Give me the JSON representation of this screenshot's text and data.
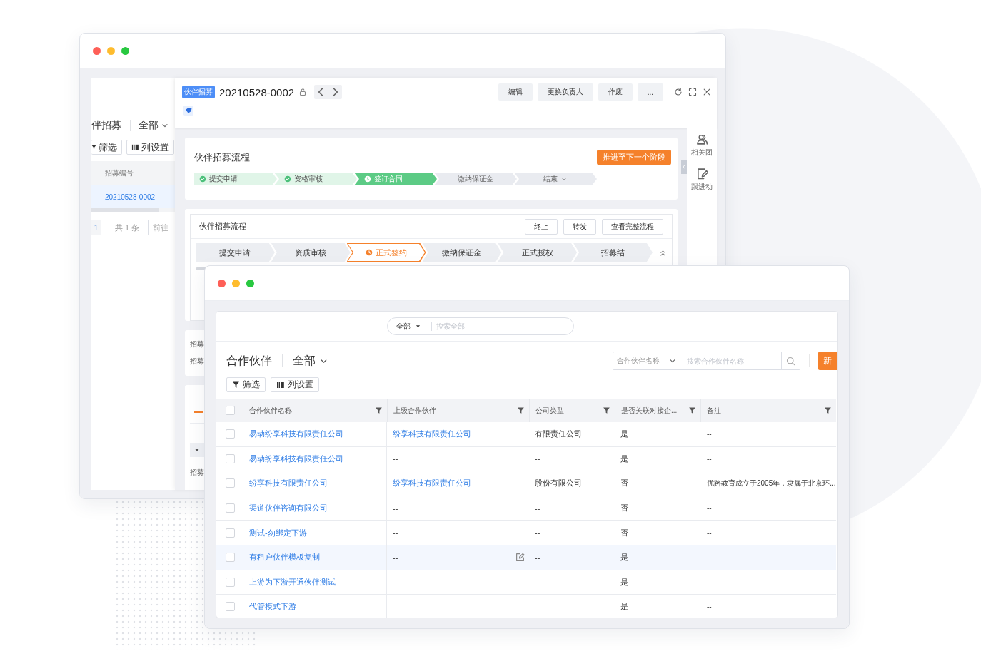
{
  "back_window": {
    "list_panel": {
      "title": "伴招募",
      "view": "全部",
      "filter_button": "筛选",
      "columns_button": "列设置",
      "columns": [
        "招募编号"
      ],
      "rows": [
        {
          "number": "20210528-0002",
          "selected": true
        }
      ],
      "pager": {
        "page": "1",
        "total": "共 1 条",
        "goto": "前往"
      }
    },
    "detail": {
      "type_tag": "伙伴招募",
      "record_number": "20210528-0002",
      "actions": [
        "编辑",
        "更换负责人",
        "作废",
        "..."
      ],
      "stage_card": {
        "title": "伙伴招募流程",
        "advance_button": "推进至下一个阶段",
        "stages": [
          {
            "label": "提交申请",
            "completed": true,
            "current": false,
            "dropdown": false
          },
          {
            "label": "资格审核",
            "completed": true,
            "current": false,
            "dropdown": false
          },
          {
            "label": "签订合同",
            "completed": false,
            "current": true,
            "dropdown": false
          },
          {
            "label": "缴纳保证金",
            "completed": false,
            "current": false,
            "dropdown": false
          },
          {
            "label": "结束",
            "completed": false,
            "current": false,
            "dropdown": true
          }
        ]
      },
      "process_card": {
        "title": "伙伴招募流程",
        "buttons": [
          "终止",
          "转发",
          "查看完整流程"
        ],
        "steps": [
          {
            "label": "提交申请",
            "current": false
          },
          {
            "label": "资质审核",
            "current": false
          },
          {
            "label": "正式签约",
            "current": true
          },
          {
            "label": "缴纳保证金",
            "current": false
          },
          {
            "label": "正式授权",
            "current": false
          },
          {
            "label": "招募结",
            "current": false
          }
        ]
      },
      "info_labels": [
        "招募",
        "招募"
      ],
      "detail_section": {
        "labels": [
          "招募"
        ]
      },
      "side_panel": [
        {
          "label": "相关团",
          "kind": "team"
        },
        {
          "label": "跟进动",
          "kind": "note"
        }
      ]
    }
  },
  "front_window": {
    "global_search": {
      "scope": "全部",
      "placeholder": "搜索全部"
    },
    "title": "合作伙伴",
    "view": "全部",
    "search": {
      "field": "合作伙伴名称",
      "placeholder": "搜索合作伙伴名称"
    },
    "new_button": "新",
    "filter_button": "筛选",
    "columns_button": "列设置",
    "table": {
      "all_checked": false,
      "columns": [
        "合作伙伴名称",
        "上级合作伙伴",
        "公司类型",
        "是否关联对接企...",
        "备注"
      ],
      "rows": [
        {
          "checked": false,
          "highlighted": false,
          "name": "易动纷享科技有限责任公司",
          "parent": "纷享科技有限责任公司",
          "parent_link": true,
          "type": "有限责任公司",
          "linked": "是",
          "note": "--"
        },
        {
          "checked": false,
          "highlighted": false,
          "name": "易动纷享科技有限责任公司",
          "parent": "--",
          "parent_link": false,
          "type": "--",
          "linked": "是",
          "note": "--"
        },
        {
          "checked": false,
          "highlighted": false,
          "name": "纷享科技有限责任公司",
          "parent": "纷享科技有限责任公司",
          "parent_link": true,
          "type": "股份有限公司",
          "linked": "否",
          "note": "优路教育成立于2005年，隶属于北京环..."
        },
        {
          "checked": false,
          "highlighted": false,
          "name": "渠道伙伴咨询有限公司",
          "parent": "--",
          "parent_link": false,
          "type": "--",
          "linked": "否",
          "note": "--"
        },
        {
          "checked": false,
          "highlighted": false,
          "name": "测试-勿绑定下游",
          "parent": "--",
          "parent_link": false,
          "type": "--",
          "linked": "否",
          "note": "--"
        },
        {
          "checked": false,
          "highlighted": true,
          "name": "有租户伙伴模板复制",
          "parent": "--",
          "parent_link": false,
          "type": "--",
          "linked": "是",
          "note": "--"
        },
        {
          "checked": false,
          "highlighted": false,
          "name": "上游为下游开通伙伴测试",
          "parent": "--",
          "parent_link": false,
          "type": "--",
          "linked": "是",
          "note": "--"
        },
        {
          "checked": false,
          "highlighted": false,
          "name": "代管模式下游",
          "parent": "--",
          "parent_link": false,
          "type": "--",
          "linked": "是",
          "note": "--"
        }
      ]
    }
  }
}
